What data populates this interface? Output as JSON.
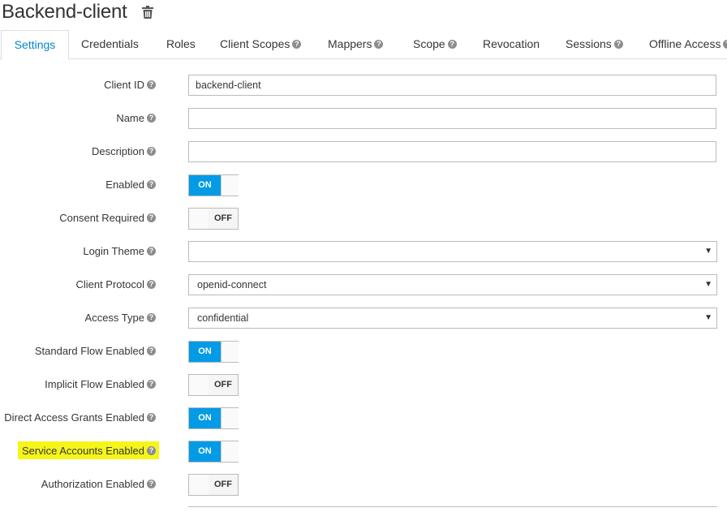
{
  "page": {
    "title": "Backend-client",
    "trash_icon": "trash-icon"
  },
  "tabs": [
    {
      "label": "Settings",
      "help": false,
      "active": true
    },
    {
      "label": "Credentials",
      "help": false
    },
    {
      "label": "Roles",
      "help": false
    },
    {
      "label": "Client Scopes",
      "help": true
    },
    {
      "label": "Mappers",
      "help": true
    },
    {
      "label": "Scope",
      "help": true
    },
    {
      "label": "Revocation",
      "help": false
    },
    {
      "label": "Sessions",
      "help": true
    },
    {
      "label": "Offline Access",
      "help": true
    }
  ],
  "form": {
    "client_id": {
      "label": "Client ID",
      "value": "backend-client"
    },
    "name": {
      "label": "Name",
      "value": ""
    },
    "description": {
      "label": "Description",
      "value": ""
    },
    "enabled": {
      "label": "Enabled",
      "state": "ON"
    },
    "consent_required": {
      "label": "Consent Required",
      "state": "OFF"
    },
    "login_theme": {
      "label": "Login Theme",
      "value": ""
    },
    "client_protocol": {
      "label": "Client Protocol",
      "value": "openid-connect"
    },
    "access_type": {
      "label": "Access Type",
      "value": "confidential"
    },
    "standard_flow": {
      "label": "Standard Flow Enabled",
      "state": "ON"
    },
    "implicit_flow": {
      "label": "Implicit Flow Enabled",
      "state": "OFF"
    },
    "direct_access": {
      "label": "Direct Access Grants Enabled",
      "state": "ON"
    },
    "service_accounts": {
      "label": "Service Accounts Enabled",
      "state": "ON",
      "highlighted": true
    },
    "authorization": {
      "label": "Authorization Enabled",
      "state": "OFF"
    }
  },
  "colors": {
    "accent": "#0088ce",
    "toggle_on": "#039be5",
    "highlight": "#f5f51a"
  }
}
